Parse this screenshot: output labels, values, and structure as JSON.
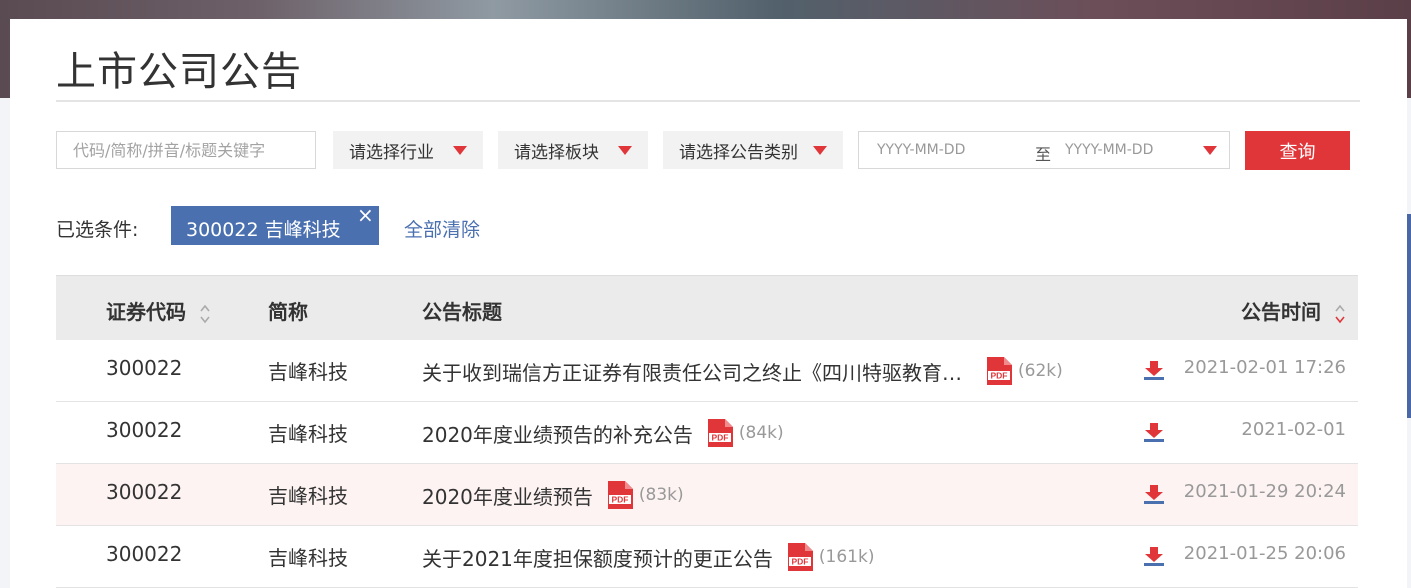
{
  "header": {
    "title": "上市公司公告"
  },
  "filters": {
    "search_placeholder": "代码/简称/拼音/标题关键字",
    "industry": "请选择行业",
    "board": "请选择板块",
    "category": "请选择公告类别",
    "date_start_placeholder": "YYYY-MM-DD",
    "date_to": "至",
    "date_end_placeholder": "YYYY-MM-DD",
    "query_button": "查询"
  },
  "conditions": {
    "label": "已选条件:",
    "chip": "300022 吉峰科技",
    "clear_all": "全部清除"
  },
  "table": {
    "headers": {
      "code": "证券代码",
      "name": "简称",
      "title": "公告标题",
      "time": "公告时间"
    },
    "rows": [
      {
        "code": "300022",
        "name": "吉峰科技",
        "title": "关于收到瑞信方正证券有限责任公司之终止《四川特驱教育…",
        "size": "(62k)",
        "time": "2021-02-01 17:26"
      },
      {
        "code": "300022",
        "name": "吉峰科技",
        "title": "2020年度业绩预告的补充公告",
        "size": "(84k)",
        "time": "2021-02-01"
      },
      {
        "code": "300022",
        "name": "吉峰科技",
        "title": "2020年度业绩预告",
        "size": "(83k)",
        "time": "2021-01-29 20:24"
      },
      {
        "code": "300022",
        "name": "吉峰科技",
        "title": "关于2021年度担保额度预计的更正公告",
        "size": "(161k)",
        "time": "2021-01-25 20:06"
      }
    ]
  },
  "colors": {
    "accent_red": "#e0363a",
    "chip_blue": "#4b70b0",
    "header_gray": "#ebebeb",
    "highlight_row": "#fdf3f3"
  },
  "icons": [
    "pdf-icon",
    "download-icon",
    "sort-icon",
    "caret-down-icon",
    "close-icon"
  ]
}
